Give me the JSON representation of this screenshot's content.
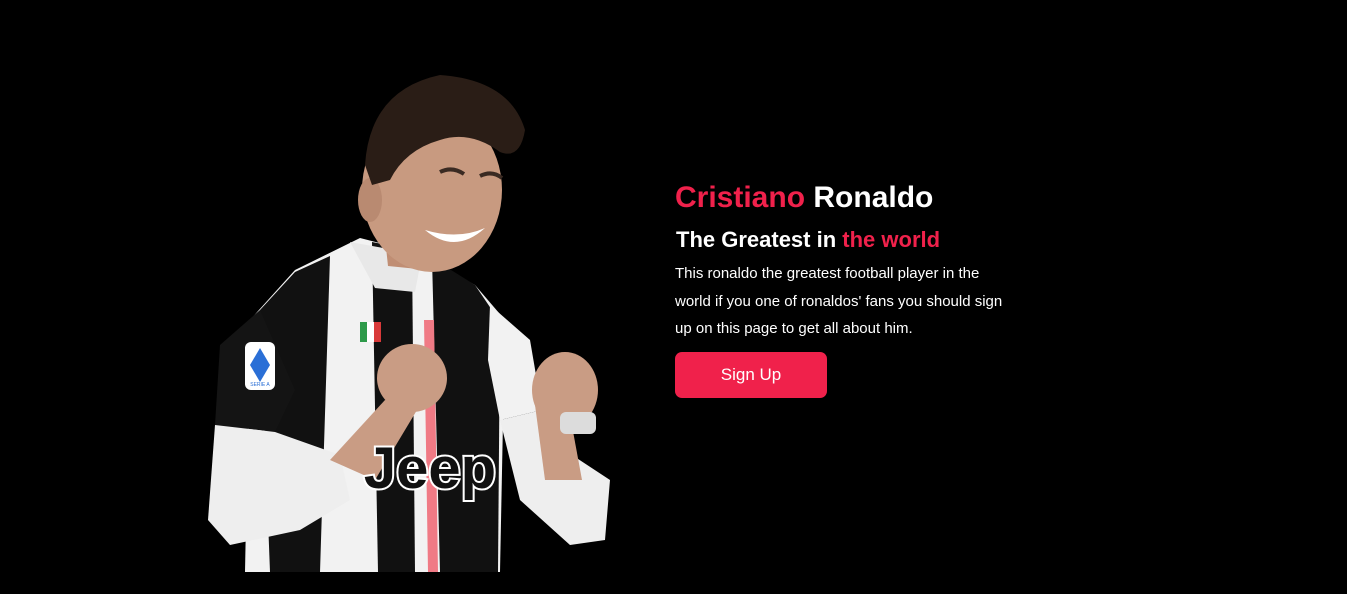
{
  "hero": {
    "title_first": "Cristiano",
    "title_last": "Ronaldo",
    "subtitle_lead": "The Greatest in",
    "subtitle_accent": "the world",
    "description": "This ronaldo the greatest football player in the world if you one of ronaldos' fans you should sign up on this page to get all about him.",
    "signup_label": "Sign Up"
  },
  "player_image": {
    "shirt_sponsor": "Jeep",
    "patch_text": "SERIE A"
  },
  "colors": {
    "accent": "#f0214b",
    "background": "#000000",
    "text": "#ffffff"
  }
}
